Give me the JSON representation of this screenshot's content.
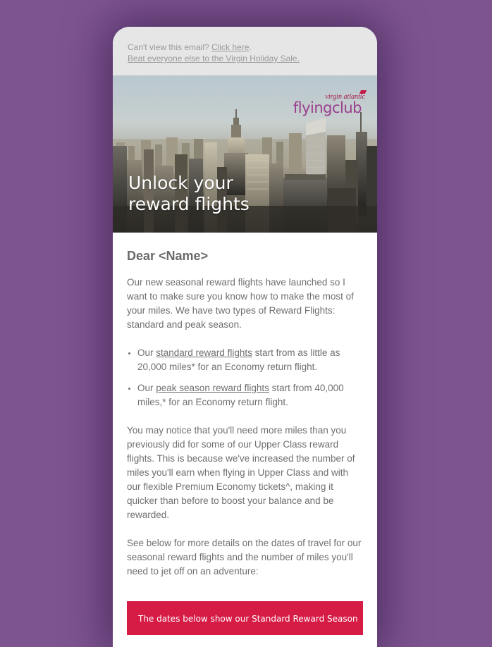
{
  "preheader": {
    "cant_view": "Can't view this email?",
    "click_here": "Click here",
    "click_here_suffix": ".",
    "subtitle": "Beat everyone else to the Virgin Holiday Sale."
  },
  "hero": {
    "logo_small": "virgin atlantic",
    "logo_big": "flyingclub",
    "title_line1": "Unlock your",
    "title_line2": "reward flights"
  },
  "email": {
    "greeting": "Dear <Name>",
    "intro": "Our new seasonal reward flights have launched so I want to make sure you know how to make the most of your miles. We have two types of Reward Flights: standard and peak season.",
    "bullet1": {
      "prefix": "Our ",
      "link": "standard reward flights",
      "suffix": " start from as little as 20,000 miles* for an Economy return flight."
    },
    "bullet2": {
      "prefix": "Our ",
      "link": "peak season reward flights",
      "suffix": " start from 40,000 miles,* for an Economy return flight."
    },
    "paragraph2": "You may notice that you'll need more miles than you previously did for some of our Upper Class reward flights. This is because we've increased the number of miles you'll earn when flying in Upper Class and with our flexible Premium Economy tickets^, making it quicker than before to boost your balance and be rewarded.",
    "paragraph3": "See below for more details on the dates of travel for our seasonal reward flights and the number of miles you'll need to jet off on an adventure:",
    "banner": "The dates below show our Standard Reward Season"
  },
  "colors": {
    "background": "#7d5490",
    "banner": "#d61b45",
    "logo": "#9b3e8c"
  }
}
